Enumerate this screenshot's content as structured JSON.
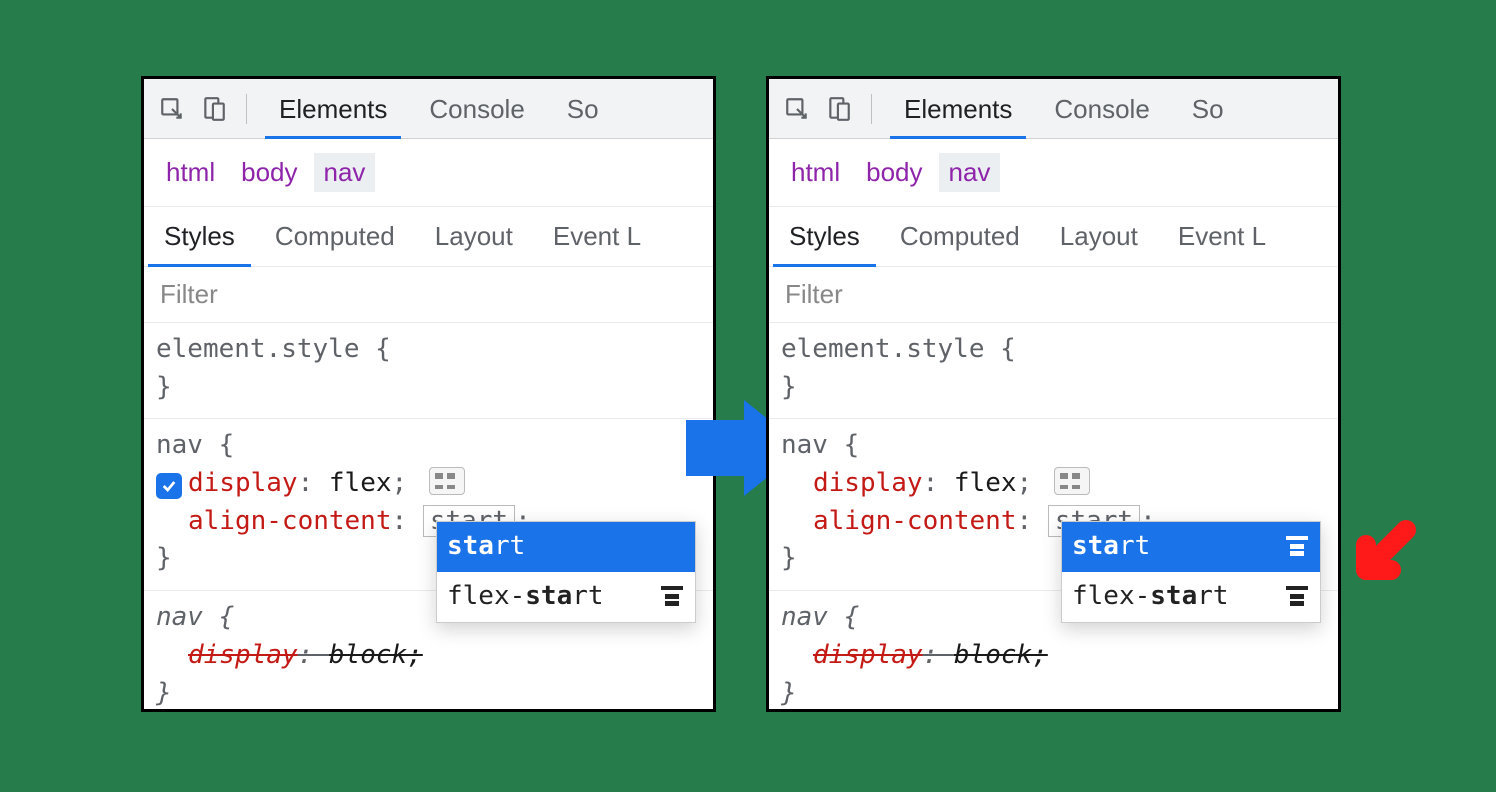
{
  "toolbar": {
    "tabs": {
      "elements": "Elements",
      "console": "Console",
      "sources_partial": "So"
    }
  },
  "breadcrumb": [
    "html",
    "body",
    "nav"
  ],
  "subtabs": {
    "styles": "Styles",
    "computed": "Computed",
    "layout": "Layout",
    "events_partial": "Event L"
  },
  "filter_placeholder": "Filter",
  "element_style": {
    "header": "element.style {",
    "close": "}"
  },
  "nav_rule": {
    "header": "nav {",
    "display_prop": "display",
    "display_val": "flex",
    "align_prop": "align-content",
    "align_val_editing": "start",
    "semicolon": ";",
    "close": "}"
  },
  "autocomplete": {
    "item1_match": "sta",
    "item1_rest": "rt",
    "item2_pre": "flex-",
    "item2_match": "sta",
    "item2_rest": "rt"
  },
  "ua_rule": {
    "header": "nav {",
    "display_prop": "display",
    "display_val": "block;",
    "close": "}"
  }
}
